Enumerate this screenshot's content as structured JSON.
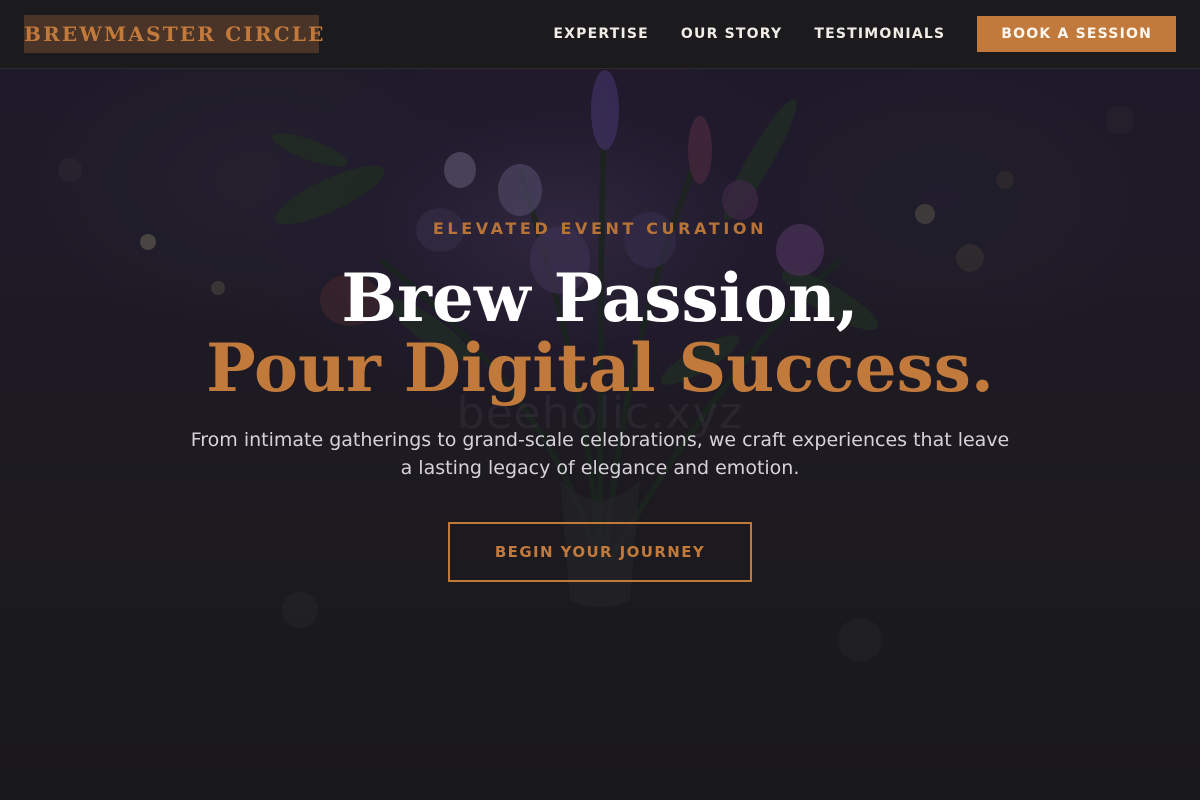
{
  "nav": {
    "logo_text": "BREWMASTER CIRCLE",
    "links": [
      {
        "label": "EXPERTISE"
      },
      {
        "label": "OUR STORY"
      },
      {
        "label": "TESTIMONIALS"
      }
    ],
    "cta_label": "BOOK A SESSION"
  },
  "hero": {
    "eyebrow": "ELEVATED EVENT CURATION",
    "headline_line1": "Brew Passion,",
    "headline_line2": "Pour Digital Success.",
    "watermark": "beeholic.xyz",
    "subtext": "From intimate gatherings to grand-scale celebrations, we craft experiences that leave a lasting legacy of elegance and emotion.",
    "cta_label": "BEGIN YOUR JOURNEY",
    "background_icon": "floral-bouquet-photo"
  },
  "colors": {
    "accent": "#c27a3c",
    "nav_background": "#1b1a1d",
    "logo_background": "#4a3327",
    "headline_white": "#ffffff",
    "body_text": "#d7d2d9"
  }
}
